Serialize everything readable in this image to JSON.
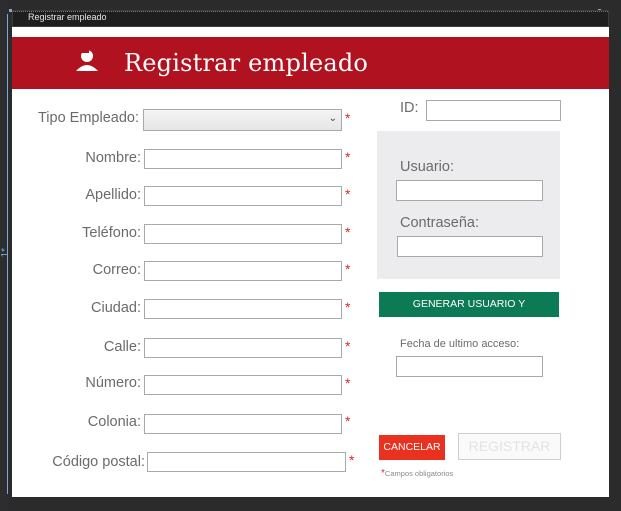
{
  "window": {
    "title": "Registrar empleado"
  },
  "designer": {
    "row_marker": "1*"
  },
  "header": {
    "title": "Registrar empleado",
    "icon": "user-icon"
  },
  "form": {
    "tipo_empleado": {
      "label": "Tipo Empleado:",
      "value": ""
    },
    "nombre": {
      "label": "Nombre:",
      "value": ""
    },
    "apellido": {
      "label": "Apellido:",
      "value": ""
    },
    "telefono": {
      "label": "Teléfono:",
      "value": ""
    },
    "correo": {
      "label": "Correo:",
      "value": ""
    },
    "ciudad": {
      "label": "Ciudad:",
      "value": ""
    },
    "calle": {
      "label": "Calle:",
      "value": ""
    },
    "numero": {
      "label": "Número:",
      "value": ""
    },
    "colonia": {
      "label": "Colonia:",
      "value": ""
    },
    "codigo_postal": {
      "label": "Código postal:",
      "value": ""
    },
    "required_mark": "*"
  },
  "side": {
    "id": {
      "label": "ID:",
      "value": ""
    },
    "usuario": {
      "label": "Usuario:",
      "value": ""
    },
    "contrasena": {
      "label": "Contraseña:",
      "value": ""
    },
    "generate_button": "GENERAR USUARIO Y CONTRASEÑA",
    "last_access": {
      "label": "Fecha de ultimo acceso:",
      "value": ""
    }
  },
  "actions": {
    "cancel": "CANCELAR",
    "register": "REGISTRAR"
  },
  "note": {
    "star": "*",
    "text": "Campos obligatorios"
  },
  "colors": {
    "banner": "#b0121f",
    "generate": "#0b7a55",
    "cancel": "#e8311f",
    "required": "#d32b2b"
  }
}
